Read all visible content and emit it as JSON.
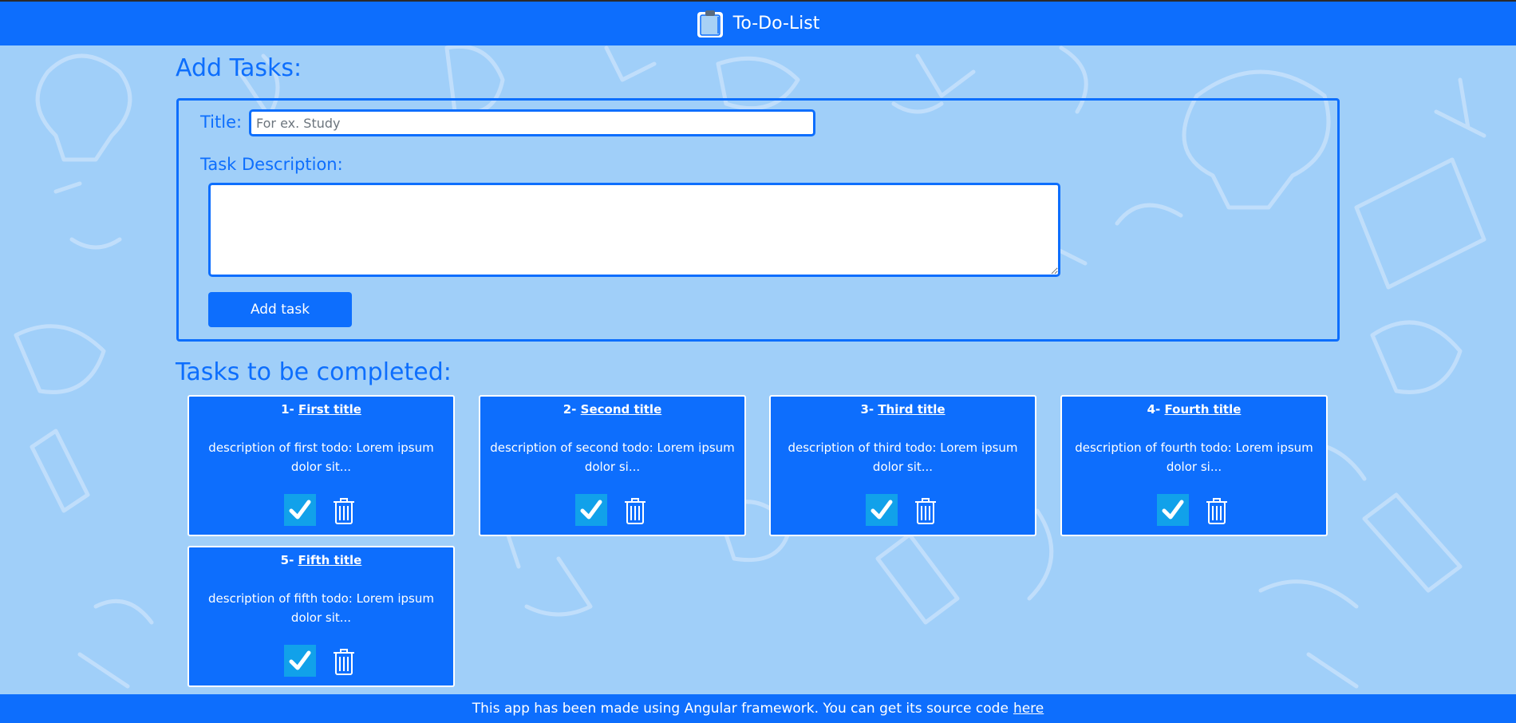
{
  "header": {
    "app_title": "To-Do-List",
    "logo_icon": "clipboard-icon"
  },
  "add_section": {
    "heading": "Add Tasks:",
    "title_label": "Title:",
    "title_placeholder": "For ex. Study",
    "title_value": "",
    "description_label": "Task Description:",
    "description_value": "",
    "add_button_label": "Add task"
  },
  "tasks_section": {
    "heading": "Tasks to be completed:",
    "complete_icon": "checkmark-icon",
    "delete_icon": "trash-icon",
    "tasks": [
      {
        "number": "1- ",
        "title": "First title",
        "description": "description of first todo: Lorem ipsum dolor sit..."
      },
      {
        "number": "2- ",
        "title": "Second title",
        "description": "description of second todo: Lorem ipsum dolor si..."
      },
      {
        "number": "3- ",
        "title": "Third title",
        "description": "description of third todo: Lorem ipsum dolor sit..."
      },
      {
        "number": "4- ",
        "title": "Fourth title",
        "description": "description of fourth todo: Lorem ipsum dolor si..."
      },
      {
        "number": "5- ",
        "title": "Fifth title",
        "description": "description of fifth todo: Lorem ipsum dolor sit..."
      }
    ]
  },
  "footer": {
    "text": "This app has been made using Angular framework. You can get its source code",
    "link_label": "here"
  },
  "colors": {
    "primary": "#0d6efd",
    "background": "#a0cff9",
    "check_button": "#11a1ea",
    "doodle_stroke": "#c6e1fb"
  }
}
